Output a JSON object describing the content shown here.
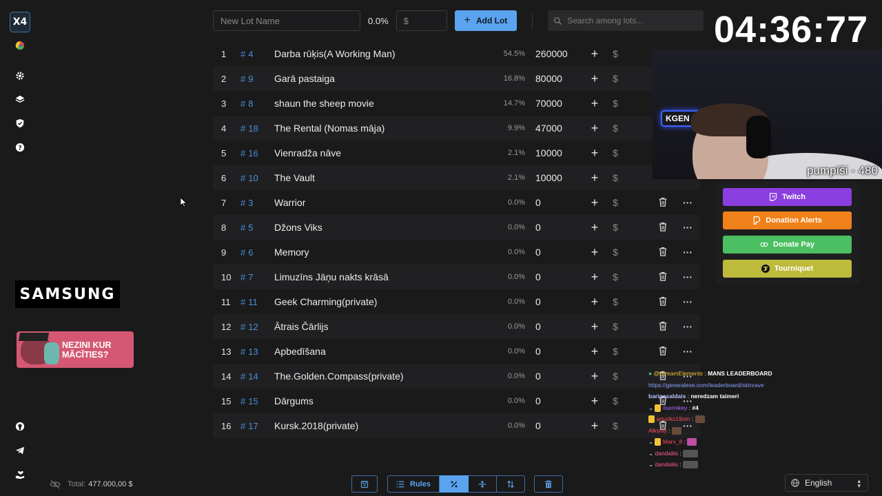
{
  "logo": "X4",
  "topbar": {
    "lot_name_placeholder": "New Lot Name",
    "percent": "0.0%",
    "amount_placeholder": "$",
    "add_lot": "Add Lot",
    "search_placeholder": "Search among lots..."
  },
  "timer": "04:36:77",
  "lots": [
    {
      "n": "1",
      "id": "4",
      "name": "Darba rūķis(A Working Man)",
      "pct": "54.5%",
      "amount": "260000"
    },
    {
      "n": "2",
      "id": "9",
      "name": "Garā pastaiga",
      "pct": "16.8%",
      "amount": "80000"
    },
    {
      "n": "3",
      "id": "8",
      "name": "shaun the sheep movie",
      "pct": "14.7%",
      "amount": "70000"
    },
    {
      "n": "4",
      "id": "18",
      "name": "The Rental (Nomas māja)",
      "pct": "9.9%",
      "amount": "47000"
    },
    {
      "n": "5",
      "id": "16",
      "name": "Vienradža nāve",
      "pct": "2.1%",
      "amount": "10000"
    },
    {
      "n": "6",
      "id": "10",
      "name": "The Vault",
      "pct": "2.1%",
      "amount": "10000"
    },
    {
      "n": "7",
      "id": "3",
      "name": "Warrior",
      "pct": "0.0%",
      "amount": "0"
    },
    {
      "n": "8",
      "id": "5",
      "name": "Džons Viks",
      "pct": "0.0%",
      "amount": "0"
    },
    {
      "n": "9",
      "id": "6",
      "name": "Memory",
      "pct": "0.0%",
      "amount": "0"
    },
    {
      "n": "10",
      "id": "7",
      "name": "Limuzīns Jāņu nakts krāsā",
      "pct": "0.0%",
      "amount": "0"
    },
    {
      "n": "11",
      "id": "11",
      "name": "Geek Charming(private)",
      "pct": "0.0%",
      "amount": "0"
    },
    {
      "n": "12",
      "id": "12",
      "name": "Ātrais Čārlijs",
      "pct": "0.0%",
      "amount": "0"
    },
    {
      "n": "13",
      "id": "13",
      "name": "Apbedīšana",
      "pct": "0.0%",
      "amount": "0"
    },
    {
      "n": "14",
      "id": "14",
      "name": "The.Golden.Compass(private)",
      "pct": "0.0%",
      "amount": "0"
    },
    {
      "n": "15",
      "id": "15",
      "name": "Dārgums",
      "pct": "0.0%",
      "amount": "0"
    },
    {
      "n": "16",
      "id": "17",
      "name": "Kursk.2018(private)",
      "pct": "0.0%",
      "amount": "0"
    }
  ],
  "row_symbols": {
    "hash": "#",
    "plus": "+",
    "dollar": "$",
    "more": "···"
  },
  "webcam": {
    "overlay_text": "pumpīši - 480",
    "sign_text": "KGEN"
  },
  "donate": {
    "twitch": "Twitch",
    "donation_alerts": "Donation Alerts",
    "donate_pay": "Donate Pay",
    "tourniquet": "Tourniquet",
    "colors": {
      "twitch": "#8a3ee0",
      "donation_alerts": "#f0811a",
      "donate_pay": "#4bbf62",
      "tourniquet": "#bdba3c"
    }
  },
  "sponsors": {
    "samsung": "SAMSUNG",
    "nezini_line1": "NEZINI KUR",
    "nezini_line2": "MĀCĪTIES?"
  },
  "chat": [
    {
      "user": "@StreamElements",
      "msg": "MANS LEADERBOARD"
    },
    {
      "link": "https://generalexe.com/leaderboard/skinrave"
    },
    {
      "user": "barigasaldais",
      "msg": "neredzam taimeri"
    },
    {
      "user": "itsemikey",
      "msg": "#4"
    },
    {
      "user": "arturiks19om",
      "msg": ""
    },
    {
      "user": "Alksniy",
      "msg": ""
    },
    {
      "user": "Marx_8",
      "msg": ""
    },
    {
      "user": "dandaliis",
      "msg": ""
    },
    {
      "user": "dandaliis",
      "msg": ""
    }
  ],
  "bottom": {
    "total_label": "Total:",
    "total_value": "477.000,00 $",
    "rules": "Rules",
    "language": "English"
  }
}
